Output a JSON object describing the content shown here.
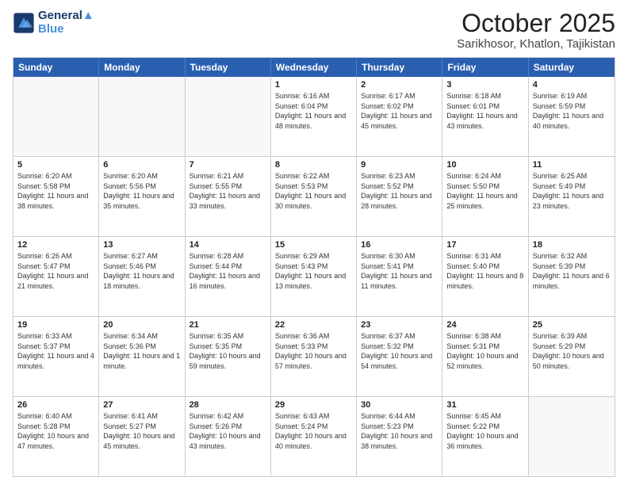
{
  "logo": {
    "line1": "General",
    "line2": "Blue"
  },
  "title": "October 2025",
  "subtitle": "Sarikhosor, Khatlon, Tajikistan",
  "header_days": [
    "Sunday",
    "Monday",
    "Tuesday",
    "Wednesday",
    "Thursday",
    "Friday",
    "Saturday"
  ],
  "rows": [
    [
      {
        "day": "",
        "text": "",
        "empty": true
      },
      {
        "day": "",
        "text": "",
        "empty": true
      },
      {
        "day": "",
        "text": "",
        "empty": true
      },
      {
        "day": "1",
        "text": "Sunrise: 6:16 AM\nSunset: 6:04 PM\nDaylight: 11 hours and 48 minutes."
      },
      {
        "day": "2",
        "text": "Sunrise: 6:17 AM\nSunset: 6:02 PM\nDaylight: 11 hours and 45 minutes."
      },
      {
        "day": "3",
        "text": "Sunrise: 6:18 AM\nSunset: 6:01 PM\nDaylight: 11 hours and 43 minutes."
      },
      {
        "day": "4",
        "text": "Sunrise: 6:19 AM\nSunset: 5:59 PM\nDaylight: 11 hours and 40 minutes."
      }
    ],
    [
      {
        "day": "5",
        "text": "Sunrise: 6:20 AM\nSunset: 5:58 PM\nDaylight: 11 hours and 38 minutes."
      },
      {
        "day": "6",
        "text": "Sunrise: 6:20 AM\nSunset: 5:56 PM\nDaylight: 11 hours and 35 minutes."
      },
      {
        "day": "7",
        "text": "Sunrise: 6:21 AM\nSunset: 5:55 PM\nDaylight: 11 hours and 33 minutes."
      },
      {
        "day": "8",
        "text": "Sunrise: 6:22 AM\nSunset: 5:53 PM\nDaylight: 11 hours and 30 minutes."
      },
      {
        "day": "9",
        "text": "Sunrise: 6:23 AM\nSunset: 5:52 PM\nDaylight: 11 hours and 28 minutes."
      },
      {
        "day": "10",
        "text": "Sunrise: 6:24 AM\nSunset: 5:50 PM\nDaylight: 11 hours and 25 minutes."
      },
      {
        "day": "11",
        "text": "Sunrise: 6:25 AM\nSunset: 5:49 PM\nDaylight: 11 hours and 23 minutes."
      }
    ],
    [
      {
        "day": "12",
        "text": "Sunrise: 6:26 AM\nSunset: 5:47 PM\nDaylight: 11 hours and 21 minutes."
      },
      {
        "day": "13",
        "text": "Sunrise: 6:27 AM\nSunset: 5:46 PM\nDaylight: 11 hours and 18 minutes."
      },
      {
        "day": "14",
        "text": "Sunrise: 6:28 AM\nSunset: 5:44 PM\nDaylight: 11 hours and 16 minutes."
      },
      {
        "day": "15",
        "text": "Sunrise: 6:29 AM\nSunset: 5:43 PM\nDaylight: 11 hours and 13 minutes."
      },
      {
        "day": "16",
        "text": "Sunrise: 6:30 AM\nSunset: 5:41 PM\nDaylight: 11 hours and 11 minutes."
      },
      {
        "day": "17",
        "text": "Sunrise: 6:31 AM\nSunset: 5:40 PM\nDaylight: 11 hours and 8 minutes."
      },
      {
        "day": "18",
        "text": "Sunrise: 6:32 AM\nSunset: 5:39 PM\nDaylight: 11 hours and 6 minutes."
      }
    ],
    [
      {
        "day": "19",
        "text": "Sunrise: 6:33 AM\nSunset: 5:37 PM\nDaylight: 11 hours and 4 minutes."
      },
      {
        "day": "20",
        "text": "Sunrise: 6:34 AM\nSunset: 5:36 PM\nDaylight: 11 hours and 1 minute."
      },
      {
        "day": "21",
        "text": "Sunrise: 6:35 AM\nSunset: 5:35 PM\nDaylight: 10 hours and 59 minutes."
      },
      {
        "day": "22",
        "text": "Sunrise: 6:36 AM\nSunset: 5:33 PM\nDaylight: 10 hours and 57 minutes."
      },
      {
        "day": "23",
        "text": "Sunrise: 6:37 AM\nSunset: 5:32 PM\nDaylight: 10 hours and 54 minutes."
      },
      {
        "day": "24",
        "text": "Sunrise: 6:38 AM\nSunset: 5:31 PM\nDaylight: 10 hours and 52 minutes."
      },
      {
        "day": "25",
        "text": "Sunrise: 6:39 AM\nSunset: 5:29 PM\nDaylight: 10 hours and 50 minutes."
      }
    ],
    [
      {
        "day": "26",
        "text": "Sunrise: 6:40 AM\nSunset: 5:28 PM\nDaylight: 10 hours and 47 minutes."
      },
      {
        "day": "27",
        "text": "Sunrise: 6:41 AM\nSunset: 5:27 PM\nDaylight: 10 hours and 45 minutes."
      },
      {
        "day": "28",
        "text": "Sunrise: 6:42 AM\nSunset: 5:26 PM\nDaylight: 10 hours and 43 minutes."
      },
      {
        "day": "29",
        "text": "Sunrise: 6:43 AM\nSunset: 5:24 PM\nDaylight: 10 hours and 40 minutes."
      },
      {
        "day": "30",
        "text": "Sunrise: 6:44 AM\nSunset: 5:23 PM\nDaylight: 10 hours and 38 minutes."
      },
      {
        "day": "31",
        "text": "Sunrise: 6:45 AM\nSunset: 5:22 PM\nDaylight: 10 hours and 36 minutes."
      },
      {
        "day": "",
        "text": "",
        "empty": true
      }
    ]
  ]
}
